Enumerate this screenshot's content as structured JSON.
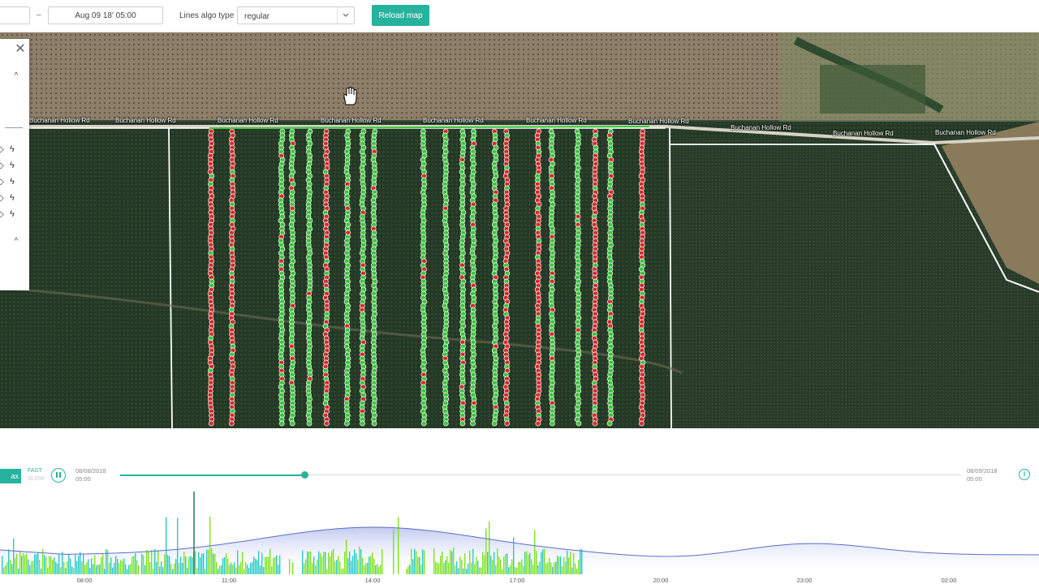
{
  "filters": {
    "from_date": "",
    "dash": "–",
    "to_date": "Aug 09 18' 05:00",
    "algo_label": "Lines algo type",
    "algo_value": "regular",
    "reload_label": "Reload map"
  },
  "map": {
    "road_labels": [
      "Buchanan Hollow Rd",
      "Buchanan Hollow Rd",
      "Buchanan Hollow Rd",
      "Buchanan Hollow Rd",
      "Buchanan Hollow Rd",
      "Buchanan Hollow Rd",
      "Buchanan Hollow Rd",
      "Buchanan Hollow Rd",
      "Buchanan Hollow Rd",
      "Buchanan Hollow Rd"
    ],
    "cursor_icon": "hand-icon",
    "row_marker_colors": {
      "good": "#3bc43b",
      "bad": "#d62a2a",
      "outline": "#ffffff"
    }
  },
  "left_panel": {
    "close_icon": "close-icon",
    "tools": [
      "bolt-icon",
      "bolt-icon",
      "bolt-icon",
      "bolt-icon",
      "bolt-icon"
    ]
  },
  "playback": {
    "max_label": "ax",
    "speed_fast": "FAST",
    "speed_slow": "SLOW",
    "start_date": "08/08/2018",
    "start_time": "05:00",
    "end_date": "08/09/2018",
    "end_time": "05:00",
    "progress": 0.22,
    "accent": "#26b39d"
  },
  "timeline": {
    "ticks": [
      "08:00",
      "11:00",
      "14:00",
      "17:00",
      "20:00",
      "23:00",
      "02:00"
    ],
    "cursor_time": "10:55",
    "colors": {
      "curve": "#5a6fc9",
      "fill_top": "#b9c3ee",
      "bars_a": "#29c9c9",
      "bars_b": "#7fe31f"
    }
  }
}
